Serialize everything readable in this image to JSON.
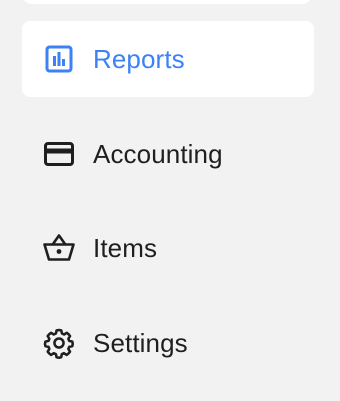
{
  "sidebar": {
    "accent_color": "#3b82f6",
    "text_color": "#1f1f1f",
    "items": [
      {
        "label": "Reports",
        "icon": "bar-chart-icon",
        "active": true
      },
      {
        "label": "Accounting",
        "icon": "credit-card-icon",
        "active": false
      },
      {
        "label": "Items",
        "icon": "basket-icon",
        "active": false
      },
      {
        "label": "Settings",
        "icon": "gear-icon",
        "active": false
      }
    ]
  }
}
